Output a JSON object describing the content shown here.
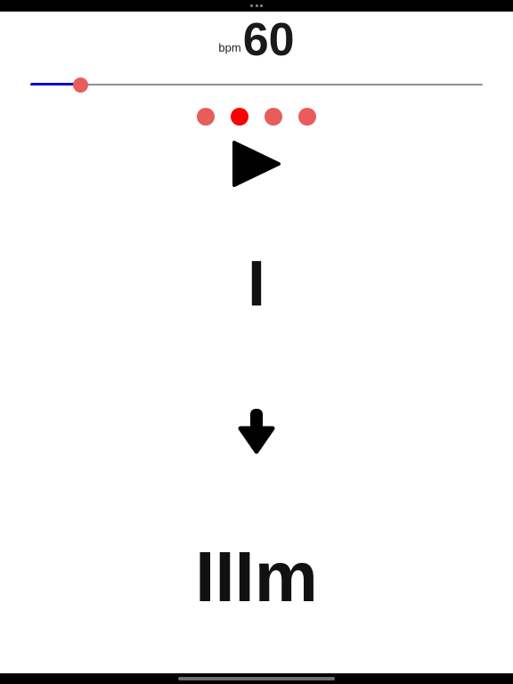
{
  "tempo": {
    "unit": "bpm",
    "value": "60"
  },
  "slider": {
    "level_fraction": 0.11,
    "fill_color": "#0a0ad6",
    "track_color": "#8e8e93",
    "thumb_color": "#e85c5c"
  },
  "beats": {
    "count": 4,
    "active_index": 1,
    "inactive_color": "#e85c5c",
    "active_color": "#ff0000"
  },
  "play": {
    "icon": "play-icon"
  },
  "current_chord": "I",
  "direction_icon": "down-arrow-icon",
  "next_chord": "IIIm"
}
